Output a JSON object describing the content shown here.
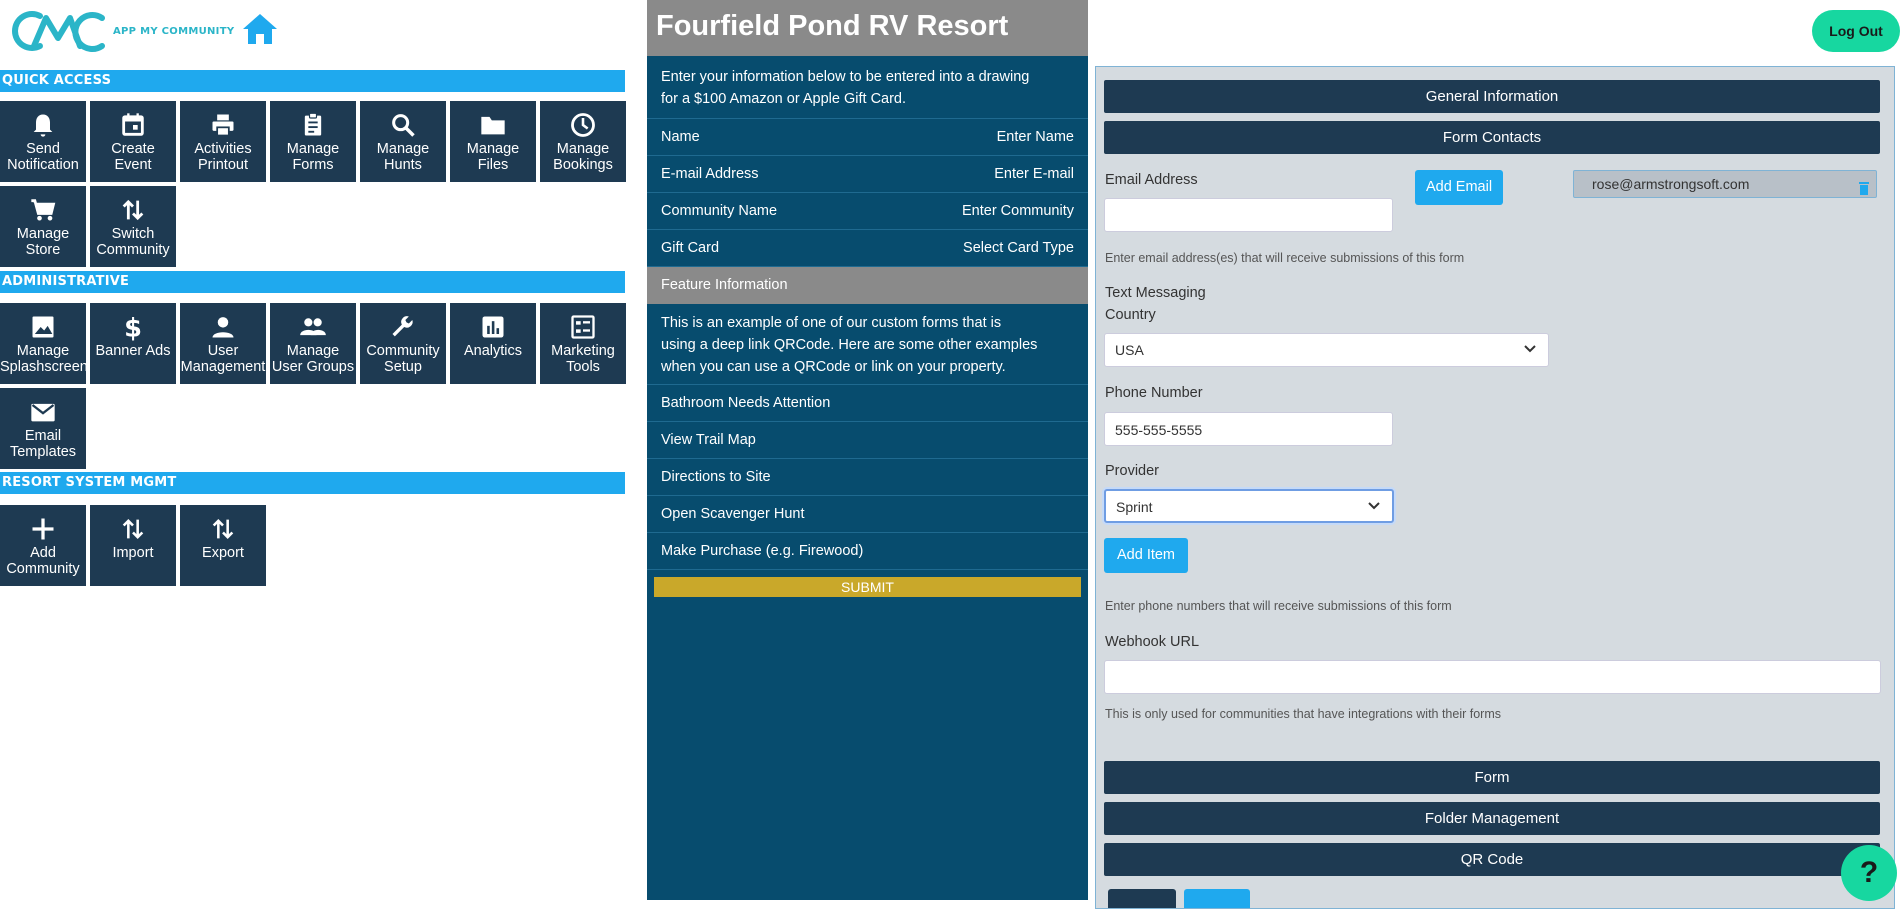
{
  "brand": {
    "logo_text": "APP MY COMMUNITY"
  },
  "nav": {
    "home_icon": "home-icon"
  },
  "sections": {
    "quick_access": "QUICK ACCESS",
    "administrative": "ADMINISTRATIVE",
    "resort": "RESORT SYSTEM MGMT"
  },
  "quick_tiles": [
    {
      "l1": "Send",
      "l2": "Notification",
      "icon": "bell-icon"
    },
    {
      "l1": "Create",
      "l2": "Event",
      "icon": "calendar-icon"
    },
    {
      "l1": "Activities",
      "l2": "Printout",
      "icon": "printer-icon"
    },
    {
      "l1": "Manage",
      "l2": "Forms",
      "icon": "clipboard-icon"
    },
    {
      "l1": "Manage",
      "l2": "Hunts",
      "icon": "search-icon"
    },
    {
      "l1": "Manage",
      "l2": "Files",
      "icon": "folder-icon"
    },
    {
      "l1": "Manage",
      "l2": "Bookings",
      "icon": "clock-icon"
    },
    {
      "l1": "Manage",
      "l2": "Store",
      "icon": "cart-icon"
    },
    {
      "l1": "Switch",
      "l2": "Community",
      "icon": "swap-icon"
    }
  ],
  "admin_tiles": [
    {
      "l1": "Manage",
      "l2": "Splashscreen",
      "icon": "image-icon"
    },
    {
      "l1": "Banner Ads",
      "l2": "",
      "icon": "dollar-icon"
    },
    {
      "l1": "User",
      "l2": "Management",
      "icon": "user-icon"
    },
    {
      "l1": "Manage",
      "l2": "User Groups",
      "icon": "users-icon"
    },
    {
      "l1": "Community",
      "l2": "Setup",
      "icon": "wrench-icon"
    },
    {
      "l1": "Analytics",
      "l2": "",
      "icon": "chart-icon"
    },
    {
      "l1": "Marketing",
      "l2": "Tools",
      "icon": "list-icon"
    },
    {
      "l1": "Email",
      "l2": "Templates",
      "icon": "mail-icon"
    }
  ],
  "resort_tiles": [
    {
      "l1": "Add",
      "l2": "Community",
      "icon": "plus-icon"
    },
    {
      "l1": "Import",
      "l2": "",
      "icon": "arrows-icon"
    },
    {
      "l1": "Export",
      "l2": "",
      "icon": "arrows-icon"
    }
  ],
  "preview": {
    "title": "Fourfield Pond RV Resort",
    "intro_1": "Enter your information below to be entered into a drawing",
    "intro_2": "for a $100 Amazon or Apple Gift Card.",
    "fields": [
      {
        "label": "Name",
        "placeholder": "Enter Name"
      },
      {
        "label": "E-mail Address",
        "placeholder": "Enter E-mail"
      },
      {
        "label": "Community Name",
        "placeholder": "Enter Community"
      },
      {
        "label": "Gift Card",
        "placeholder": "Select Card Type"
      }
    ],
    "feature_header": "Feature Information",
    "desc_1": "This is an example of one of our custom forms that is",
    "desc_2": "using a deep link QRCode. Here are some other examples",
    "desc_3": "when you can use a QRCode or link on your property.",
    "links": [
      "Bathroom Needs Attention",
      "View Trail Map",
      "Directions to Site",
      "Open Scavenger Hunt",
      "Make Purchase (e.g. Firewood)"
    ],
    "submit": "SUBMIT"
  },
  "header": {
    "logout": "Log Out"
  },
  "form": {
    "general_info": "General Information",
    "form_contacts": "Form Contacts",
    "email_label": "Email Address",
    "email_value": "",
    "add_email": "Add Email",
    "email_chip": "rose@armstrongsoft.com",
    "email_hint": "Enter email address(es) that will receive submissions of this form",
    "text_messaging": "Text Messaging",
    "country_label": "Country",
    "country_value": "USA",
    "phone_label": "Phone Number",
    "phone_value": "555-555-5555",
    "provider_label": "Provider",
    "provider_value": "Sprint",
    "add_item": "Add Item",
    "phone_hint": "Enter phone numbers that will receive submissions of this form",
    "webhook_label": "Webhook URL",
    "webhook_value": "",
    "webhook_hint": "This is only used for communities that have integrations with their forms",
    "form_section": "Form",
    "folder_section": "Folder Management",
    "qr_section": "QR Code"
  },
  "help": {
    "label": "?"
  }
}
